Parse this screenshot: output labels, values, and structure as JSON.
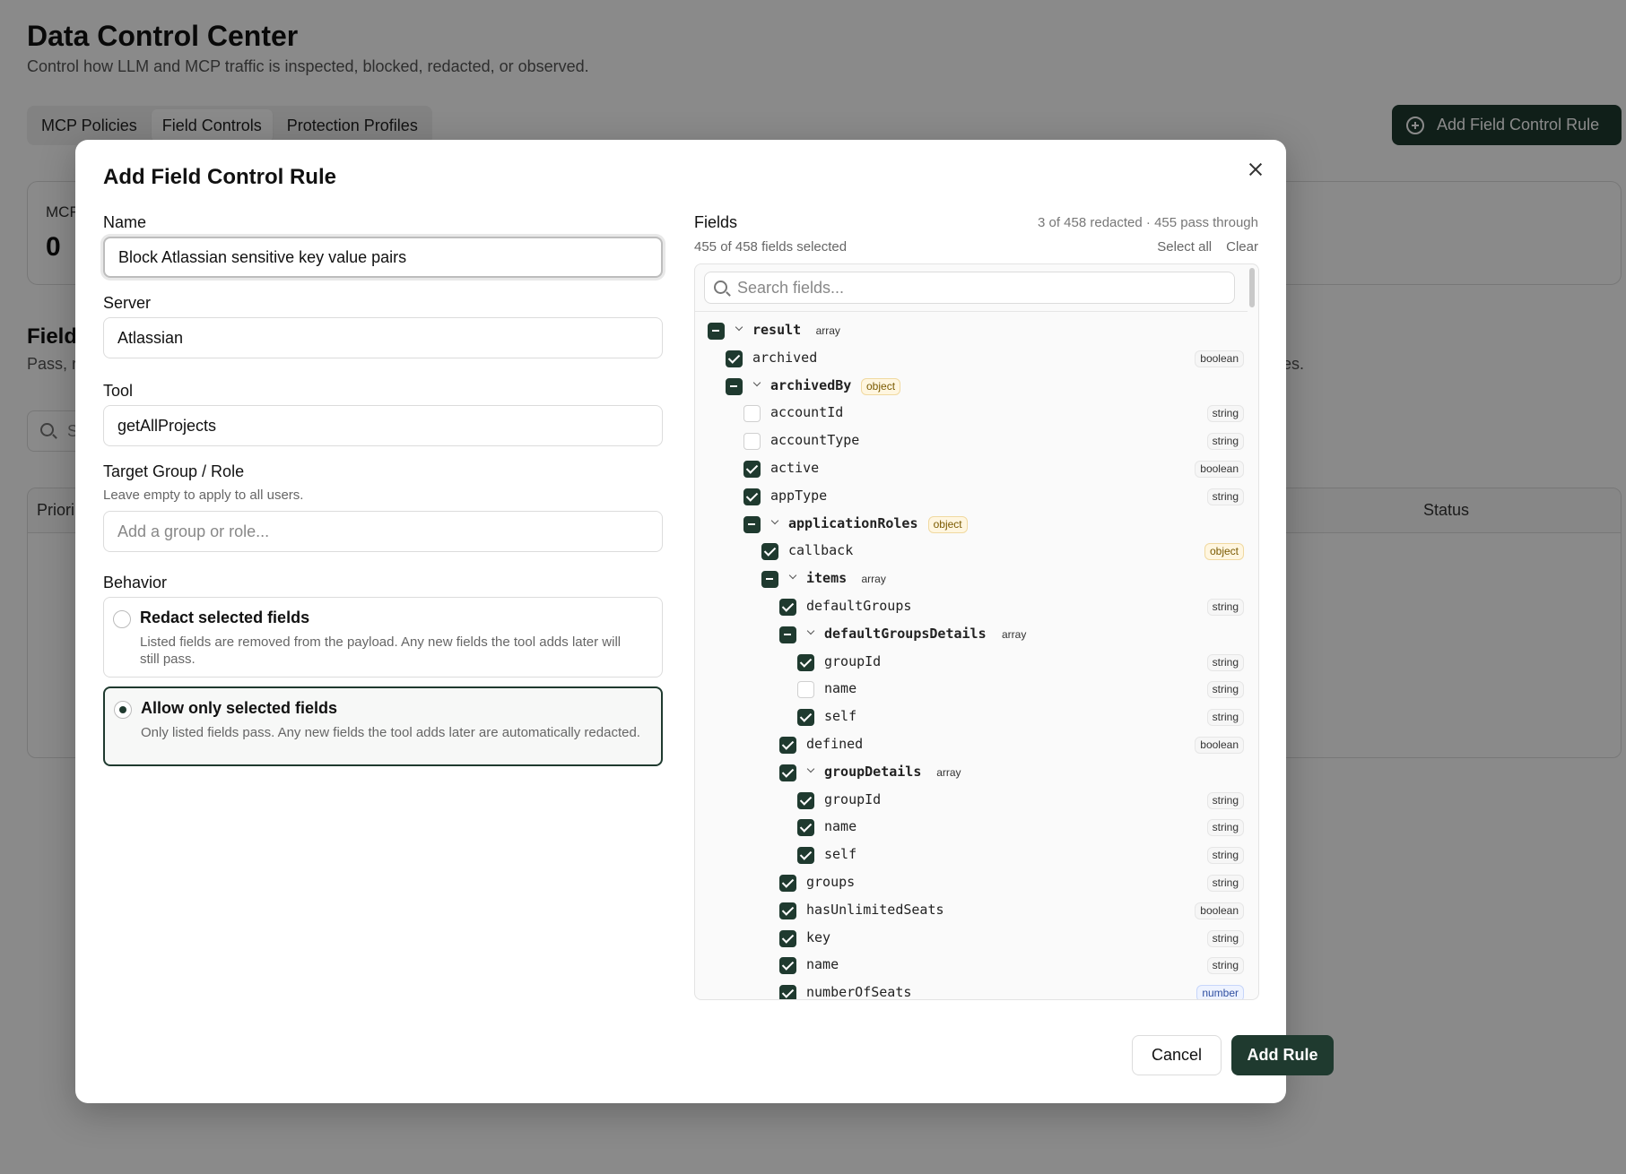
{
  "page": {
    "title": "Data Control Center",
    "subtitle": "Control how LLM and MCP traffic is inspected, blocked, redacted, or observed.",
    "tabs": [
      {
        "label": "MCP Policies",
        "active": false
      },
      {
        "label": "Field Controls",
        "active": true
      },
      {
        "label": "Protection Profiles",
        "active": false
      }
    ],
    "add_button_label": "Add Field Control Rule",
    "stat_label": "MCF",
    "stat_value": "0",
    "section_title": "Field",
    "section_desc": "Pass, r",
    "section_desc_end": "es.",
    "search_placeholder": "S",
    "table_headers": {
      "first": "Priori",
      "status": "Status"
    }
  },
  "modal": {
    "title": "Add Field Control Rule",
    "name": {
      "label": "Name",
      "value": "Block Atlassian sensitive key value pairs"
    },
    "server": {
      "label": "Server",
      "value": "Atlassian"
    },
    "tool": {
      "label": "Tool",
      "value": "getAllProjects"
    },
    "target": {
      "label": "Target Group / Role",
      "hint": "Leave empty to apply to all users.",
      "placeholder": "Add a group or role..."
    },
    "behavior": {
      "label": "Behavior",
      "options": [
        {
          "title": "Redact selected fields",
          "desc": "Listed fields are removed from the payload. Any new fields the tool adds later will still pass.",
          "selected": false
        },
        {
          "title": "Allow only selected fields",
          "desc": "Only listed fields pass. Any new fields the tool adds later are automatically redacted.",
          "selected": true
        }
      ]
    },
    "fields": {
      "label": "Fields",
      "summary": "3 of 458 redacted · 455 pass through",
      "selected_count": "455 of 458 fields selected",
      "select_all": "Select all",
      "clear": "Clear",
      "search_placeholder": "Search fields...",
      "tree": [
        {
          "name": "result",
          "type": "array",
          "depth": 0,
          "state": "partial",
          "group": true
        },
        {
          "name": "archived",
          "type": "boolean",
          "depth": 1,
          "state": "checked",
          "group": false
        },
        {
          "name": "archivedBy",
          "type": "object",
          "depth": 1,
          "state": "partial",
          "group": true
        },
        {
          "name": "accountId",
          "type": "string",
          "depth": 2,
          "state": "unchecked",
          "group": false
        },
        {
          "name": "accountType",
          "type": "string",
          "depth": 2,
          "state": "unchecked",
          "group": false
        },
        {
          "name": "active",
          "type": "boolean",
          "depth": 2,
          "state": "checked",
          "group": false
        },
        {
          "name": "appType",
          "type": "string",
          "depth": 2,
          "state": "checked",
          "group": false
        },
        {
          "name": "applicationRoles",
          "type": "object",
          "depth": 2,
          "state": "partial",
          "group": true
        },
        {
          "name": "callback",
          "type": "object",
          "depth": 3,
          "state": "checked",
          "group": false
        },
        {
          "name": "items",
          "type": "array",
          "depth": 3,
          "state": "partial",
          "group": true
        },
        {
          "name": "defaultGroups",
          "type": "string",
          "depth": 4,
          "state": "checked",
          "group": false
        },
        {
          "name": "defaultGroupsDetails",
          "type": "array",
          "depth": 4,
          "state": "partial",
          "group": true
        },
        {
          "name": "groupId",
          "type": "string",
          "depth": 5,
          "state": "checked",
          "group": false
        },
        {
          "name": "name",
          "type": "string",
          "depth": 5,
          "state": "unchecked",
          "group": false
        },
        {
          "name": "self",
          "type": "string",
          "depth": 5,
          "state": "checked",
          "group": false
        },
        {
          "name": "defined",
          "type": "boolean",
          "depth": 4,
          "state": "checked",
          "group": false
        },
        {
          "name": "groupDetails",
          "type": "array",
          "depth": 4,
          "state": "checked",
          "group": true
        },
        {
          "name": "groupId",
          "type": "string",
          "depth": 5,
          "state": "checked",
          "group": false
        },
        {
          "name": "name",
          "type": "string",
          "depth": 5,
          "state": "checked",
          "group": false
        },
        {
          "name": "self",
          "type": "string",
          "depth": 5,
          "state": "checked",
          "group": false
        },
        {
          "name": "groups",
          "type": "string",
          "depth": 4,
          "state": "checked",
          "group": false
        },
        {
          "name": "hasUnlimitedSeats",
          "type": "boolean",
          "depth": 4,
          "state": "checked",
          "group": false
        },
        {
          "name": "key",
          "type": "string",
          "depth": 4,
          "state": "checked",
          "group": false
        },
        {
          "name": "name",
          "type": "string",
          "depth": 4,
          "state": "checked",
          "group": false
        },
        {
          "name": "numberOfSeats",
          "type": "number",
          "depth": 4,
          "state": "checked",
          "group": false
        }
      ]
    },
    "cancel_label": "Cancel",
    "submit_label": "Add Rule"
  },
  "colors": {
    "accent": "#1f3a2f",
    "overlay": "rgba(0,0,0,0.46)"
  }
}
